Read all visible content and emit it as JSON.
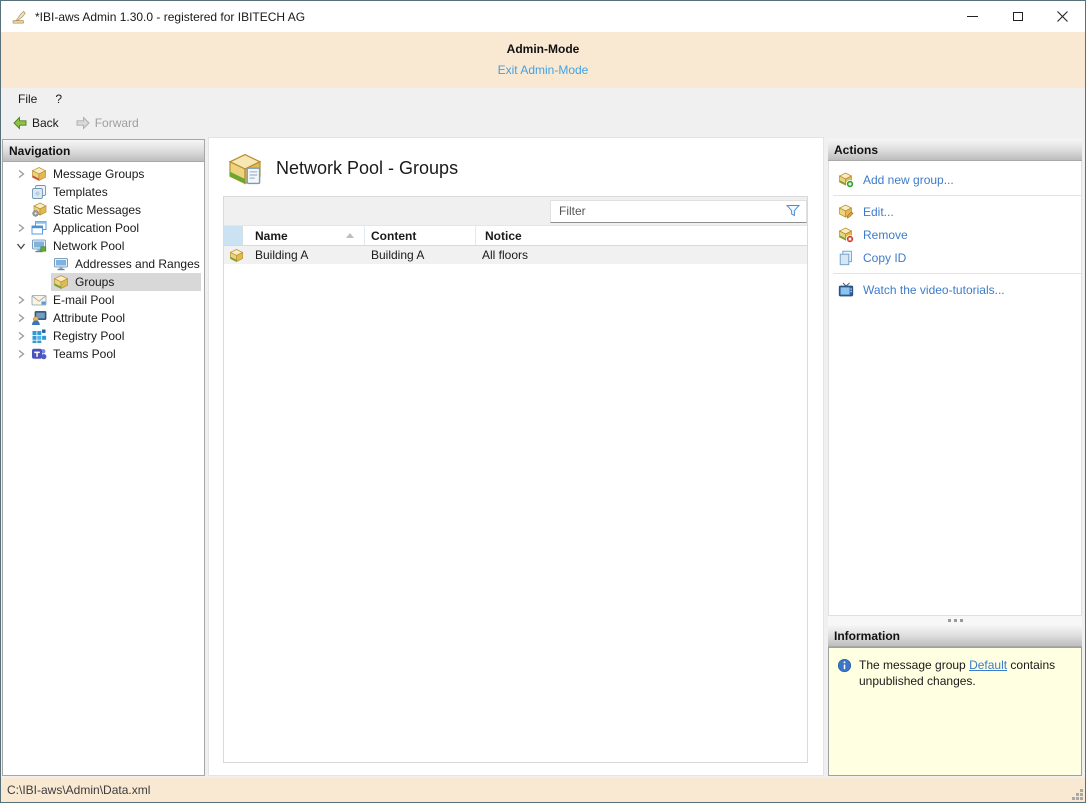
{
  "window": {
    "title": "*IBI-aws Admin 1.30.0 - registered for IBITECH AG",
    "app_icon": "stamp-icon",
    "controls": [
      "minimize",
      "maximize",
      "close"
    ]
  },
  "admin_banner": {
    "title": "Admin-Mode",
    "exit_link": "Exit Admin-Mode"
  },
  "menu_bar": {
    "items": [
      "File",
      "?"
    ]
  },
  "toolbar": {
    "back_label": "Back",
    "forward_label": "Forward"
  },
  "navigation": {
    "header": "Navigation",
    "items": [
      {
        "label": "Message Groups",
        "icon": "message-groups-icon",
        "chevron": "collapsed",
        "level": 1,
        "selected": false
      },
      {
        "label": "Templates",
        "icon": "templates-icon",
        "chevron": "none",
        "level": 1,
        "selected": false
      },
      {
        "label": "Static Messages",
        "icon": "static-messages-icon",
        "chevron": "none",
        "level": 1,
        "selected": false
      },
      {
        "label": "Application Pool",
        "icon": "application-pool-icon",
        "chevron": "collapsed",
        "level": 1,
        "selected": false
      },
      {
        "label": "Network Pool",
        "icon": "network-pool-icon",
        "chevron": "expanded",
        "level": 1,
        "selected": false
      },
      {
        "label": "Addresses and Ranges",
        "icon": "addresses-ranges-icon",
        "chevron": "none",
        "level": 2,
        "selected": false
      },
      {
        "label": "Groups",
        "icon": "groups-icon",
        "chevron": "none",
        "level": 2,
        "selected": true
      },
      {
        "label": "E-mail Pool",
        "icon": "email-pool-icon",
        "chevron": "collapsed",
        "level": 1,
        "selected": false
      },
      {
        "label": "Attribute Pool",
        "icon": "attribute-pool-icon",
        "chevron": "collapsed",
        "level": 1,
        "selected": false
      },
      {
        "label": "Registry Pool",
        "icon": "registry-pool-icon",
        "chevron": "collapsed",
        "level": 1,
        "selected": false
      },
      {
        "label": "Teams Pool",
        "icon": "teams-pool-icon",
        "chevron": "collapsed",
        "level": 1,
        "selected": false
      }
    ]
  },
  "main": {
    "title": "Network Pool - Groups",
    "title_icon": "group-box-icon",
    "filter": {
      "placeholder": "Filter",
      "icon": "filter-funnel-icon"
    },
    "table": {
      "columns": [
        "Name",
        "Content",
        "Notice"
      ],
      "sort": {
        "column": "Name",
        "direction": "ascending"
      },
      "rows": [
        {
          "icon": "group-box-icon",
          "name": "Building A",
          "content": "Building A",
          "notice": "All floors"
        }
      ]
    }
  },
  "actions": {
    "header": "Actions",
    "items": [
      {
        "label": "Add new group...",
        "icon": "add-group-icon"
      },
      {
        "label": "Edit...",
        "icon": "edit-group-icon"
      },
      {
        "label": "Remove",
        "icon": "remove-group-icon"
      },
      {
        "label": "Copy ID",
        "icon": "copy-id-icon"
      },
      {
        "label": "Watch the video-tutorials...",
        "icon": "tv-icon"
      }
    ]
  },
  "information": {
    "header": "Information",
    "icon": "info-icon",
    "message_prefix": "The message group ",
    "link_text": "Default",
    "message_suffix": " contains unpublished changes."
  },
  "status_bar": {
    "path": "C:\\IBI-aws\\Admin\\Data.xml"
  },
  "colors": {
    "banner_bg": "#f9e9d3",
    "status_bg": "#f9e9d3",
    "info_bg": "#ffffe1",
    "link_blue": "#3d7cc9",
    "exit_link_blue": "#3fa2e6",
    "selection_column_blue": "#cbe2f3",
    "row_bg": "#f1f1f1",
    "panel_header_gradient_bottom": "#bdbdbd"
  }
}
